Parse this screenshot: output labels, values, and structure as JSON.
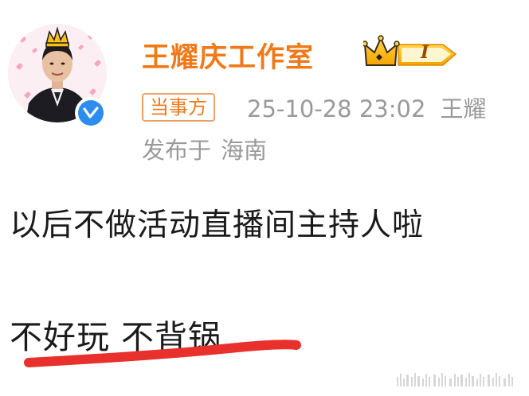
{
  "post": {
    "author": "王耀庆工作室",
    "badge": "当事方",
    "timestamp": "25-10-28 23:02",
    "author_tail": "王耀",
    "location_prefix": "发布于",
    "location": "海南",
    "vip_level": "I"
  },
  "content": {
    "line1": "以后不做活动直播间主持人啦",
    "line2": "不好玩 不背锅"
  },
  "colors": {
    "username": "#f07a1a",
    "meta": "#9a9a9a",
    "verified": "#2d8cf0",
    "underline": "#e8302d"
  }
}
